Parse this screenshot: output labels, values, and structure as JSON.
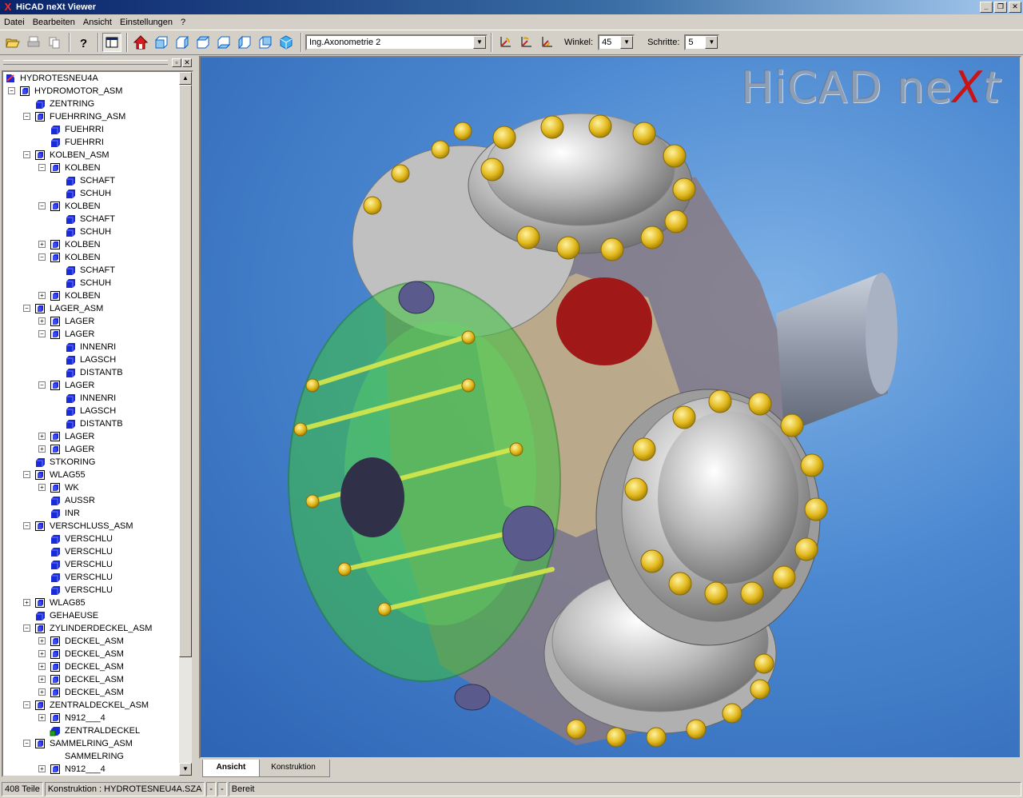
{
  "window": {
    "title": "HiCAD neXt Viewer",
    "app_icon": "X"
  },
  "menu": [
    "Datei",
    "Bearbeiten",
    "Ansicht",
    "Einstellungen",
    "?"
  ],
  "toolbar": {
    "view_select": "Ing.Axonometrie 2",
    "winkel_label": "Winkel:",
    "winkel_value": "45",
    "schritte_label": "Schritte:",
    "schritte_value": "5"
  },
  "tree": [
    {
      "label": "HYDROTESNEU4A",
      "level": 0,
      "exp": "",
      "icon": "root"
    },
    {
      "label": "HYDROMOTOR_ASM",
      "level": 0,
      "exp": "-",
      "icon": "asm"
    },
    {
      "label": "ZENTRING",
      "level": 1,
      "exp": "",
      "icon": "part"
    },
    {
      "label": "FUEHRRING_ASM",
      "level": 1,
      "exp": "-",
      "icon": "asm"
    },
    {
      "label": "FUEHRRI",
      "level": 2,
      "exp": "",
      "icon": "part"
    },
    {
      "label": "FUEHRRI",
      "level": 2,
      "exp": "",
      "icon": "part"
    },
    {
      "label": "KOLBEN_ASM",
      "level": 1,
      "exp": "-",
      "icon": "asm"
    },
    {
      "label": "KOLBEN",
      "level": 2,
      "exp": "-",
      "icon": "asm"
    },
    {
      "label": "SCHAFT",
      "level": 3,
      "exp": "",
      "icon": "part"
    },
    {
      "label": "SCHUH",
      "level": 3,
      "exp": "",
      "icon": "part"
    },
    {
      "label": "KOLBEN",
      "level": 2,
      "exp": "-",
      "icon": "asm"
    },
    {
      "label": "SCHAFT",
      "level": 3,
      "exp": "",
      "icon": "part"
    },
    {
      "label": "SCHUH",
      "level": 3,
      "exp": "",
      "icon": "part"
    },
    {
      "label": "KOLBEN",
      "level": 2,
      "exp": "+",
      "icon": "asm"
    },
    {
      "label": "KOLBEN",
      "level": 2,
      "exp": "-",
      "icon": "asm"
    },
    {
      "label": "SCHAFT",
      "level": 3,
      "exp": "",
      "icon": "part"
    },
    {
      "label": "SCHUH",
      "level": 3,
      "exp": "",
      "icon": "part"
    },
    {
      "label": "KOLBEN",
      "level": 2,
      "exp": "+",
      "icon": "asm"
    },
    {
      "label": "LAGER_ASM",
      "level": 1,
      "exp": "-",
      "icon": "asm"
    },
    {
      "label": "LAGER",
      "level": 2,
      "exp": "+",
      "icon": "asm"
    },
    {
      "label": "LAGER",
      "level": 2,
      "exp": "-",
      "icon": "asm"
    },
    {
      "label": "INNENRI",
      "level": 3,
      "exp": "",
      "icon": "part"
    },
    {
      "label": "LAGSCH",
      "level": 3,
      "exp": "",
      "icon": "part"
    },
    {
      "label": "DISTANTB",
      "level": 3,
      "exp": "",
      "icon": "part"
    },
    {
      "label": "LAGER",
      "level": 2,
      "exp": "-",
      "icon": "asm"
    },
    {
      "label": "INNENRI",
      "level": 3,
      "exp": "",
      "icon": "part"
    },
    {
      "label": "LAGSCH",
      "level": 3,
      "exp": "",
      "icon": "part"
    },
    {
      "label": "DISTANTB",
      "level": 3,
      "exp": "",
      "icon": "part"
    },
    {
      "label": "LAGER",
      "level": 2,
      "exp": "+",
      "icon": "asm"
    },
    {
      "label": "LAGER",
      "level": 2,
      "exp": "+",
      "icon": "asm"
    },
    {
      "label": "STKORING",
      "level": 1,
      "exp": "",
      "icon": "part"
    },
    {
      "label": "WLAG55",
      "level": 1,
      "exp": "-",
      "icon": "asm"
    },
    {
      "label": "WK",
      "level": 2,
      "exp": "+",
      "icon": "asm"
    },
    {
      "label": "AUSSR",
      "level": 2,
      "exp": "",
      "icon": "part"
    },
    {
      "label": "INR",
      "level": 2,
      "exp": "",
      "icon": "part"
    },
    {
      "label": "VERSCHLUSS_ASM",
      "level": 1,
      "exp": "-",
      "icon": "asm"
    },
    {
      "label": "VERSCHLU",
      "level": 2,
      "exp": "",
      "icon": "part"
    },
    {
      "label": "VERSCHLU",
      "level": 2,
      "exp": "",
      "icon": "part"
    },
    {
      "label": "VERSCHLU",
      "level": 2,
      "exp": "",
      "icon": "part"
    },
    {
      "label": "VERSCHLU",
      "level": 2,
      "exp": "",
      "icon": "part"
    },
    {
      "label": "VERSCHLU",
      "level": 2,
      "exp": "",
      "icon": "part"
    },
    {
      "label": "WLAG85",
      "level": 1,
      "exp": "+",
      "icon": "asm"
    },
    {
      "label": "GEHAEUSE",
      "level": 1,
      "exp": "",
      "icon": "part"
    },
    {
      "label": "ZYLINDERDECKEL_ASM",
      "level": 1,
      "exp": "-",
      "icon": "asm"
    },
    {
      "label": "DECKEL_ASM",
      "level": 2,
      "exp": "+",
      "icon": "asm"
    },
    {
      "label": "DECKEL_ASM",
      "level": 2,
      "exp": "+",
      "icon": "asm"
    },
    {
      "label": "DECKEL_ASM",
      "level": 2,
      "exp": "+",
      "icon": "asm"
    },
    {
      "label": "DECKEL_ASM",
      "level": 2,
      "exp": "+",
      "icon": "asm"
    },
    {
      "label": "DECKEL_ASM",
      "level": 2,
      "exp": "+",
      "icon": "asm"
    },
    {
      "label": "ZENTRALDECKEL_ASM",
      "level": 1,
      "exp": "-",
      "icon": "asm"
    },
    {
      "label": "N912___4",
      "level": 2,
      "exp": "+",
      "icon": "asm"
    },
    {
      "label": "ZENTRALDECKEL",
      "level": 2,
      "exp": "",
      "icon": "greenpart"
    },
    {
      "label": "SAMMELRING_ASM",
      "level": 1,
      "exp": "-",
      "icon": "asm"
    },
    {
      "label": "SAMMELRING",
      "level": 2,
      "exp": "",
      "icon": "none"
    },
    {
      "label": "N912___4",
      "level": 2,
      "exp": "+",
      "icon": "asm"
    }
  ],
  "viewport": {
    "brand_main": "HiCAD ne",
    "brand_x": "X",
    "brand_t": "t"
  },
  "tabs": {
    "ansicht": "Ansicht",
    "konstruktion": "Konstruktion"
  },
  "status": {
    "parts": "408 Teile",
    "konstruktion": "Konstruktion : HYDROTESNEU4A.SZA",
    "f1": "-",
    "f2": "-",
    "state": "Bereit"
  },
  "colors": {
    "title_from": "#0a246a",
    "title_to": "#a6caf0",
    "viewport_bg": "#4a87d0",
    "part_icon": "#1a2ad8",
    "bolt": "#e0b818",
    "transparent_part": "#3cc23c",
    "brand_x": "#c81414"
  }
}
